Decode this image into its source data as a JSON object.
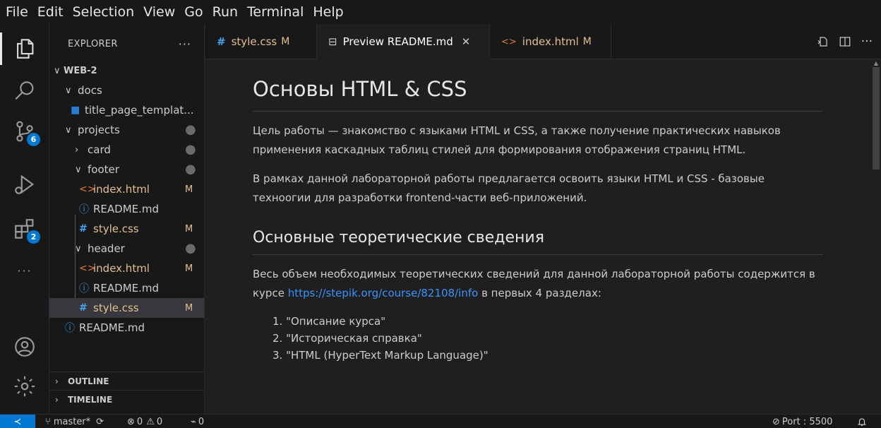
{
  "menubar": {
    "items": [
      "File",
      "Edit",
      "Selection",
      "View",
      "Go",
      "Run",
      "Terminal",
      "Help"
    ]
  },
  "activitybar": {
    "scm_badge": "6",
    "extensions_badge": "2",
    "more": "···"
  },
  "sidebar": {
    "title": "EXPLORER",
    "more": "···",
    "tree": [
      {
        "label": "WEB-2",
        "status": ""
      },
      {
        "label": "docs",
        "status": ""
      },
      {
        "label": "title_page_templat...",
        "status": ""
      },
      {
        "label": "projects",
        "status": "●"
      },
      {
        "label": "card",
        "status": "●"
      },
      {
        "label": "footer",
        "status": "●"
      },
      {
        "label": "index.html",
        "status": "M"
      },
      {
        "label": "README.md",
        "status": ""
      },
      {
        "label": "style.css",
        "status": "M"
      },
      {
        "label": "header",
        "status": "●"
      },
      {
        "label": "index.html",
        "status": "M"
      },
      {
        "label": "README.md",
        "status": ""
      },
      {
        "label": "style.css",
        "status": "M"
      },
      {
        "label": "README.md",
        "status": ""
      }
    ],
    "outline": "OUTLINE",
    "timeline": "TIMELINE"
  },
  "tabs": [
    {
      "icon": "#",
      "label": "style.css",
      "status": "M"
    },
    {
      "icon": "⊟",
      "label": "Preview README.md",
      "close": "✕"
    },
    {
      "icon": "<>",
      "label": "index.html",
      "status": "M"
    }
  ],
  "tab_actions": {
    "more": "···"
  },
  "preview": {
    "h1": "Основы HTML & CSS",
    "p1": "Цель работы — знакомство с языками HTML и CSS, а также получение практических навыков применения каскадных таблиц стилей для формирования отображения страниц HTML.",
    "p2": "В рамках данной лабораторной работы предлагается освоить языки HTML и CSS - базовые техноогии для разработки frontend-части веб-приложений.",
    "h2": "Основные теоретические сведения",
    "p3_before": "Весь объем необходимых теоретических сведений для данной лабораторной работы содержится в курсе ",
    "p3_link": "https://stepik.org/course/82108/info",
    "p3_after": " в первых 4 разделах:",
    "list": [
      "\"Описание курса\"",
      "\"Историческая справка\"",
      "\"HTML (HyperText Markup Language)\""
    ]
  },
  "statusbar": {
    "remote": "≺",
    "branch": "master*",
    "errors": "0",
    "warnings": "0",
    "ports": "0",
    "port_label": "Port : 5500"
  }
}
